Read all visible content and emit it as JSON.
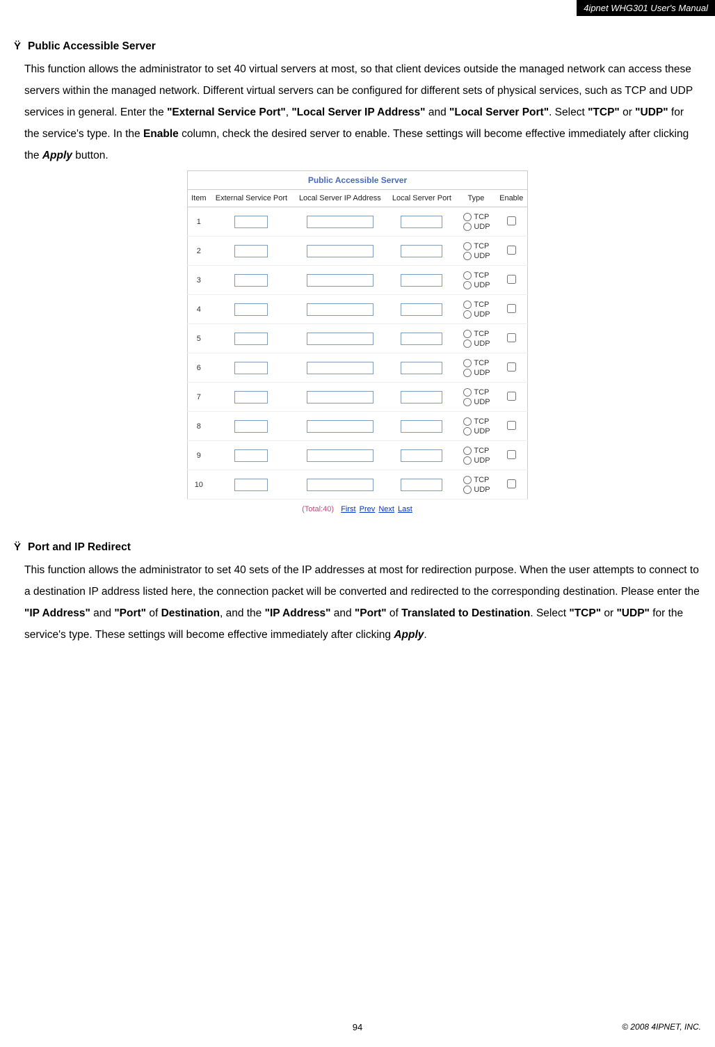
{
  "header": {
    "title": "4ipnet WHG301 User's Manual"
  },
  "bullet_char": "Ÿ",
  "section1": {
    "heading": "Public Accessible Server",
    "para_parts": {
      "p1": "This function allows the administrator to set 40 virtual servers at most, so that client devices outside the managed network can access these servers within the managed network. Different virtual servers can be configured for different sets of physical services, such as TCP and UDP services in general. Enter the ",
      "b1": "\"External Service Port\"",
      "t2": ", ",
      "b2": "\"Local Server IP Address\"",
      "t3": " and ",
      "b3": "\"Local Server Port\"",
      "t4": ". Select ",
      "b4": "\"TCP\"",
      "t5": " or ",
      "b5": "\"UDP\"",
      "t6": " for the service's type. In the ",
      "b6": "Enable",
      "t7": " column, check the desired server to enable. These settings will become effective immediately after clicking the ",
      "b7": "Apply",
      "t8": " button."
    },
    "ui": {
      "caption": "Public Accessible Server",
      "headers": {
        "item": "Item",
        "ext": "External Service Port",
        "ip": "Local Server IP Address",
        "port": "Local Server Port",
        "type": "Type",
        "enable": "Enable"
      },
      "type_labels": {
        "tcp": "TCP",
        "udp": "UDP"
      },
      "rows": [
        {
          "n": "1"
        },
        {
          "n": "2"
        },
        {
          "n": "3"
        },
        {
          "n": "4"
        },
        {
          "n": "5"
        },
        {
          "n": "6"
        },
        {
          "n": "7"
        },
        {
          "n": "8"
        },
        {
          "n": "9"
        },
        {
          "n": "10"
        }
      ],
      "pager": {
        "total": "(Total:40)",
        "first": "First",
        "prev": "Prev",
        "next": "Next",
        "last": "Last"
      }
    }
  },
  "section2": {
    "heading": "Port and IP Redirect",
    "para_parts": {
      "p1": "This function allows the administrator to set 40 sets of the IP addresses at most for redirection purpose. When the user attempts to connect to a destination IP address listed here, the connection packet will be converted and redirected to the corresponding destination. Please enter the ",
      "b1": "\"IP Address\"",
      "t2": " and ",
      "b2": "\"Port\"",
      "t3": " of ",
      "b3": "Destination",
      "t4": ", and the ",
      "b4": "\"IP Address\"",
      "t5": " and ",
      "b5": "\"Port\"",
      "t6": " of ",
      "b6": "Translated to Destination",
      "t7": ". Select ",
      "b7": "\"TCP\"",
      "t8": " or ",
      "b8": "\"UDP\"",
      "t9": " for the service's type. These settings will become effective immediately after clicking ",
      "b9": "Apply",
      "t10": "."
    }
  },
  "footer": {
    "page": "94",
    "copyright": "© 2008 4IPNET, INC."
  }
}
